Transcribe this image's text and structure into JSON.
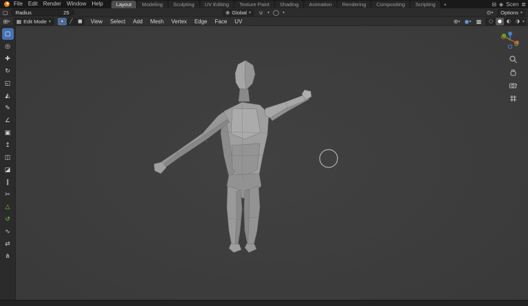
{
  "topbar": {
    "menus": [
      "File",
      "Edit",
      "Render",
      "Window",
      "Help"
    ],
    "tabs": [
      "Layout",
      "Modeling",
      "Sculpting",
      "UV Editing",
      "Texture Paint",
      "Shading",
      "Animation",
      "Rendering",
      "Compositing",
      "Scripting"
    ],
    "add_tab_label": "+",
    "scene_label": "Scen"
  },
  "tool_settings": {
    "radius_label": "Radius",
    "radius_value": "25",
    "orientation_label": "Global",
    "options_label": "Options"
  },
  "viewport_header": {
    "mode_label": "Edit Mode",
    "menus": [
      "View",
      "Select",
      "Add",
      "Mesh",
      "Vertex",
      "Edge",
      "Face",
      "UV"
    ]
  },
  "left_toolbar": {
    "tools": [
      {
        "name": "select-box",
        "glyph": "▢"
      },
      {
        "name": "cursor",
        "glyph": "◎"
      },
      {
        "name": "move",
        "glyph": "✚"
      },
      {
        "name": "rotate",
        "glyph": "↻"
      },
      {
        "name": "scale",
        "glyph": "◱"
      },
      {
        "name": "transform",
        "glyph": "◭"
      },
      {
        "name": "annotate",
        "glyph": "✎"
      },
      {
        "name": "measure",
        "glyph": "∠"
      },
      {
        "name": "add-cube",
        "glyph": "▣"
      },
      {
        "name": "extrude-region",
        "glyph": "↥"
      },
      {
        "name": "inset-faces",
        "glyph": "◫"
      },
      {
        "name": "bevel",
        "glyph": "◪"
      },
      {
        "name": "loop-cut",
        "glyph": "∥"
      },
      {
        "name": "knife",
        "glyph": "✂"
      },
      {
        "name": "poly-build",
        "glyph": "△"
      },
      {
        "name": "spin",
        "glyph": "↺"
      },
      {
        "name": "smooth",
        "glyph": "∿"
      },
      {
        "name": "edge-slide",
        "glyph": "⇄"
      },
      {
        "name": "rip-region",
        "glyph": "⋔"
      }
    ]
  },
  "glyphs": {
    "chevron": "▾",
    "screen": "⊟",
    "scene": "◈",
    "view_layer": "≣",
    "active_tool": "▢",
    "orientation": "⊕",
    "magnet": "∪",
    "proportional": "◯",
    "visibility": "⊙",
    "editor_type": "⊞",
    "mode": "▦",
    "select_vertex": "∙",
    "select_edge": "╱",
    "select_face": "■",
    "gizmos": "⊛",
    "overlays": "◉",
    "xray": "▩",
    "shading_wireframe": "○",
    "shading_solid": "●",
    "shading_material": "◐",
    "shading_rendered": "◑"
  }
}
